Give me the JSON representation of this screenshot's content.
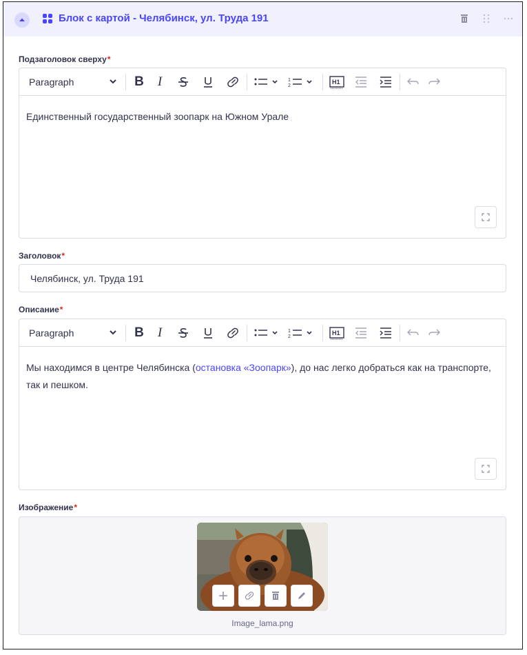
{
  "block": {
    "title": "Блок с картой - Челябинск, ул. Труда 191",
    "colors": {
      "accent": "#4945ff",
      "header_bg": "#f0f0ff",
      "required": "#d02b20"
    }
  },
  "subtitle_field": {
    "label": "Подзаголовок сверху",
    "required_mark": "*",
    "toolbar": {
      "paragraph": "Paragraph",
      "bold": "B",
      "italic": "I"
    },
    "text": "Единственный государственный зоопарк на Южном Урале"
  },
  "heading_field": {
    "label": "Заголовок",
    "required_mark": "*",
    "value": "Челябинск, ул. Труда 191"
  },
  "description_field": {
    "label": "Описание",
    "required_mark": "*",
    "toolbar": {
      "paragraph": "Paragraph",
      "bold": "B",
      "italic": "I"
    },
    "text_before": "Мы находимся в центре Челябинска (",
    "link_text": "остановка «Зоопарк»",
    "text_after": "), до нас легко добраться как на транспорте, так и пешком."
  },
  "image_field": {
    "label": "Изображение",
    "required_mark": "*",
    "filename": "Image_lama.png"
  }
}
